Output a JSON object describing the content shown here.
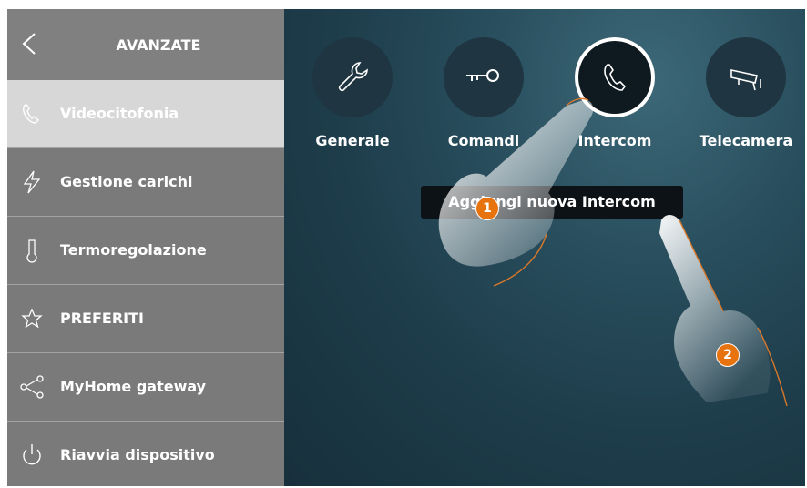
{
  "sidebar": {
    "title": "AVANZATE",
    "items": [
      {
        "label": "Videocitofonia",
        "icon": "phone-icon",
        "active": true
      },
      {
        "label": "Gestione carichi",
        "icon": "lightning-icon",
        "active": false
      },
      {
        "label": "Termoregolazione",
        "icon": "thermometer-icon",
        "active": false
      },
      {
        "label": "PREFERITI",
        "icon": "star-icon",
        "active": false
      },
      {
        "label": "MyHome gateway",
        "icon": "share-icon",
        "active": false
      },
      {
        "label": "Riavvia dispositivo",
        "icon": "power-icon",
        "active": false
      }
    ]
  },
  "main": {
    "categories": [
      {
        "label": "Generale",
        "icon": "wrench-icon"
      },
      {
        "label": "Comandi",
        "icon": "key-icon"
      },
      {
        "label": "Intercom",
        "icon": "phone-icon",
        "selected": true
      },
      {
        "label": "Telecamera",
        "icon": "camera-icon"
      }
    ],
    "add_button": "Aggiungi nuova Intercom"
  },
  "steps": [
    "1",
    "2"
  ],
  "colors": {
    "sidebar_bg": "#7a7a7a",
    "active_item_bg": "#d7d7d7",
    "main_bg": "#1d3644",
    "badge": "#e7730f"
  }
}
